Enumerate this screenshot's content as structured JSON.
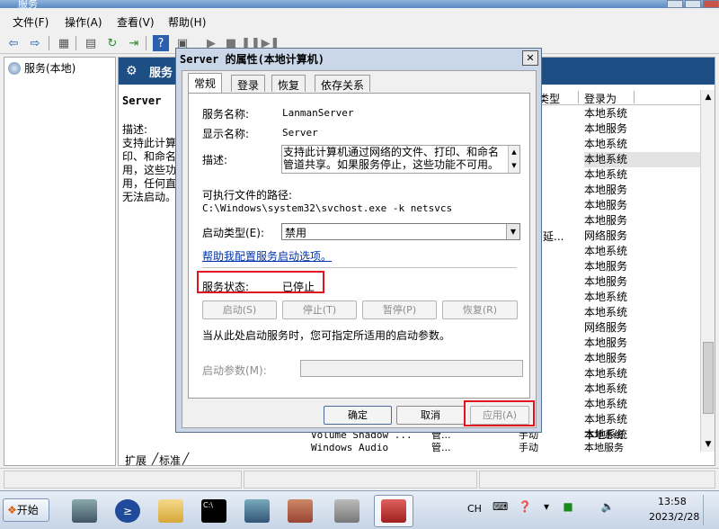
{
  "window": {
    "title": "服务"
  },
  "menu": [
    "文件(F)",
    "操作(A)",
    "查看(V)",
    "帮助(H)"
  ],
  "left_pane": {
    "root_label": "服务(本地)"
  },
  "right_pane": {
    "header_title": "服务",
    "selected_service_name": "Server",
    "description_text": "描述:\n支持此计算机通过网络的文件、打印、和命名管道共享。如果服务停止，这些功能不可用。如果服务被禁用，任何直接依赖于此服务的服务都将无法启动。",
    "description_visible": "描述:\n支持此计算\n印、和命名\n用，这些功\n用，任何直\n无法启动。",
    "columns": {
      "type": "类型",
      "logon": "登录为"
    },
    "logon_values": [
      "本地系统",
      "本地服务",
      "本地系统",
      "本地系统",
      "本地系统",
      "本地服务",
      "本地服务",
      "本地服务",
      "网络服务",
      "本地系统",
      "本地服务",
      "本地服务",
      "本地系统",
      "本地系统",
      "网络服务",
      "本地服务",
      "本地服务",
      "本地系统",
      "本地系统",
      "本地系统",
      "本地系统",
      "本地系统"
    ],
    "type_extra": "延...",
    "bottom_rows": [
      {
        "name": "Volume Shadow ...",
        "desc": "管...",
        "start": "手动",
        "logon": "本地系统"
      },
      {
        "name": "Windows Audio",
        "desc": "管...",
        "start": "手动",
        "logon": "本地服务"
      }
    ],
    "view_tabs": [
      "扩展",
      "标准"
    ]
  },
  "dialog": {
    "title": "Server 的属性(本地计算机)",
    "tabs": [
      "常规",
      "登录",
      "恢复",
      "依存关系"
    ],
    "service_name_label": "服务名称:",
    "service_name_value": "LanmanServer",
    "display_name_label": "显示名称:",
    "display_name_value": "Server",
    "description_label": "描述:",
    "description_value": "支持此计算机通过网络的文件、打印、和命名管道共享。如果服务停止，这些功能不可用。",
    "exe_path_label": "可执行文件的路径:",
    "exe_path_value": "C:\\Windows\\system32\\svchost.exe -k netsvcs",
    "startup_type_label": "启动类型(E):",
    "startup_type_value": "禁用",
    "help_link": "帮助我配置服务启动选项。",
    "status_label": "服务状态:",
    "status_value": "已停止",
    "buttons": {
      "start": "启动(S)",
      "stop": "停止(T)",
      "pause": "暂停(P)",
      "resume": "恢复(R)"
    },
    "hint_text": "当从此处启动服务时，您可指定所适用的启动参数。",
    "params_label": "启动参数(M):",
    "footer": {
      "ok": "确定",
      "cancel": "取消",
      "apply": "应用(A)"
    }
  },
  "taskbar": {
    "start_label": "开始",
    "lang": "CH",
    "time": "13:58",
    "date": "2023/2/28"
  },
  "colors": {
    "highlight_box": "#e0141e",
    "header_bg": "#1e4f84",
    "link": "#0033aa"
  }
}
